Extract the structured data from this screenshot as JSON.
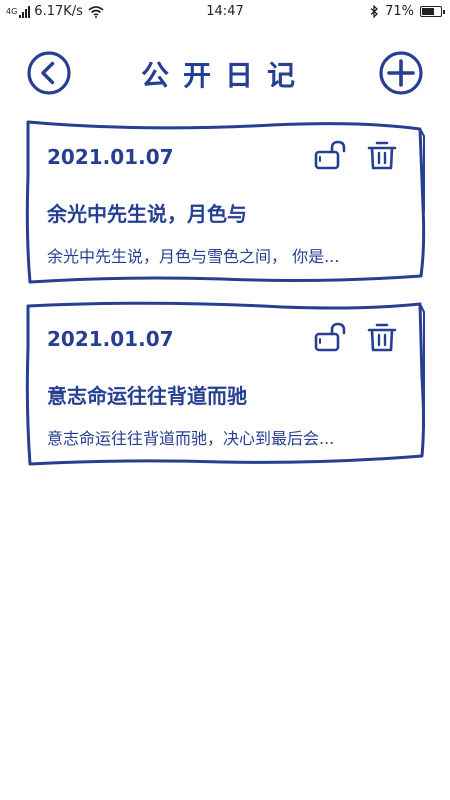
{
  "status_bar": {
    "network_type": "4G",
    "speed": "6.17K/s",
    "time": "14:47",
    "battery": "71%",
    "battery_level": 0.71
  },
  "header": {
    "title": "公开日记"
  },
  "diaries": [
    {
      "date": "2021.01.07",
      "title": "余光中先生说，月色与",
      "preview": "余光中先生说，月色与雪色之间， 你是..."
    },
    {
      "date": "2021.01.07",
      "title": "意志命运往往背道而驰",
      "preview": "意志命运往往背道而驰，决心到最后会..."
    }
  ],
  "colors": {
    "accent": "#263f92"
  }
}
